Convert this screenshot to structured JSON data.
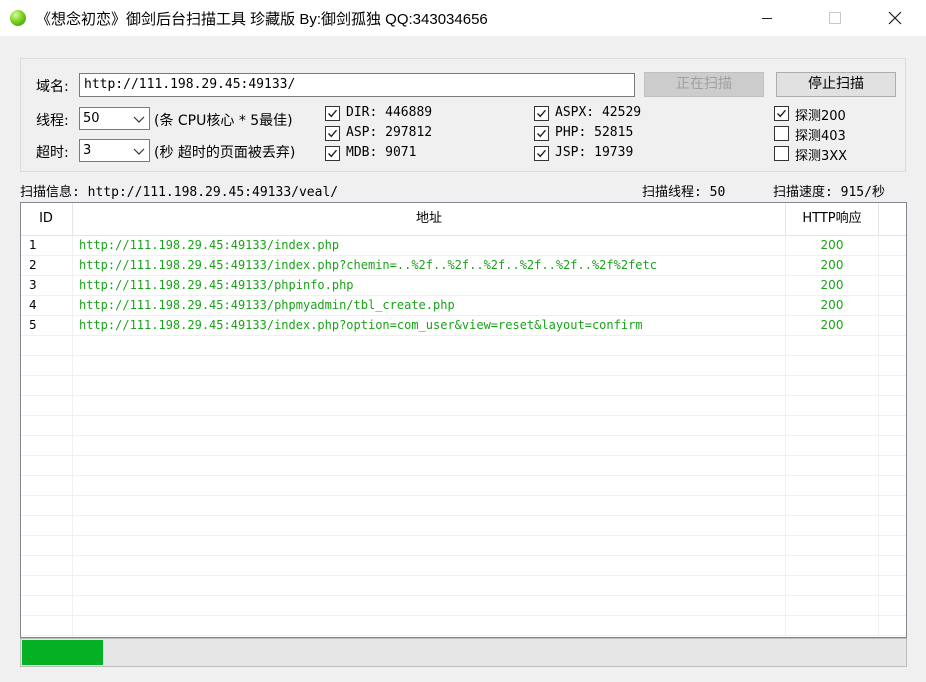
{
  "window": {
    "title": "《想念初恋》御剑后台扫描工具 珍藏版 By:御剑孤独 QQ:343034656",
    "icon": "green-ball-icon",
    "controls": [
      "minimize-icon",
      "maximize-icon",
      "close-icon"
    ]
  },
  "form": {
    "domain_label": "域名:",
    "domain_value": "http://111.198.29.45:49133/",
    "threads_label": "线程:",
    "threads_value": "50",
    "threads_hint": "(条 CPU核心 * 5最佳)",
    "timeout_label": "超时:",
    "timeout_value": "3",
    "timeout_hint": "(秒 超时的页面被丢弃)",
    "scanning_button": "正在扫描",
    "stop_button": "停止扫描"
  },
  "dictionaries": [
    {
      "label": "DIR: 446889",
      "checked": true
    },
    {
      "label": "ASP: 297812",
      "checked": true
    },
    {
      "label": "MDB: 9071",
      "checked": true
    },
    {
      "label": "ASPX: 42529",
      "checked": true
    },
    {
      "label": "PHP: 52815",
      "checked": true
    },
    {
      "label": "JSP: 19739",
      "checked": true
    }
  ],
  "probes": [
    {
      "label": "探测200",
      "checked": true
    },
    {
      "label": "探测403",
      "checked": false
    },
    {
      "label": "探测3XX",
      "checked": false
    }
  ],
  "status": {
    "scan_info": "扫描信息: http://111.198.29.45:49133/veal/",
    "scan_threads": "扫描线程: 50",
    "scan_speed": "扫描速度: 915/秒"
  },
  "table": {
    "columns": [
      "ID",
      "地址",
      "HTTP响应"
    ],
    "rows": [
      {
        "id": "1",
        "url": "http://111.198.29.45:49133/index.php",
        "code": "200"
      },
      {
        "id": "2",
        "url": "http://111.198.29.45:49133/index.php?chemin=..%2f..%2f..%2f..%2f..%2f..%2f%2fetc",
        "code": "200"
      },
      {
        "id": "3",
        "url": "http://111.198.29.45:49133/phpinfo.php",
        "code": "200"
      },
      {
        "id": "4",
        "url": "http://111.198.29.45:49133/phpmyadmin/tbl_create.php",
        "code": "200"
      },
      {
        "id": "5",
        "url": "http://111.198.29.45:49133/index.php?option=com_user&view=reset&layout=confirm",
        "code": "200"
      }
    ]
  },
  "progress": {
    "fraction": 0.092,
    "color": "#06b025"
  }
}
